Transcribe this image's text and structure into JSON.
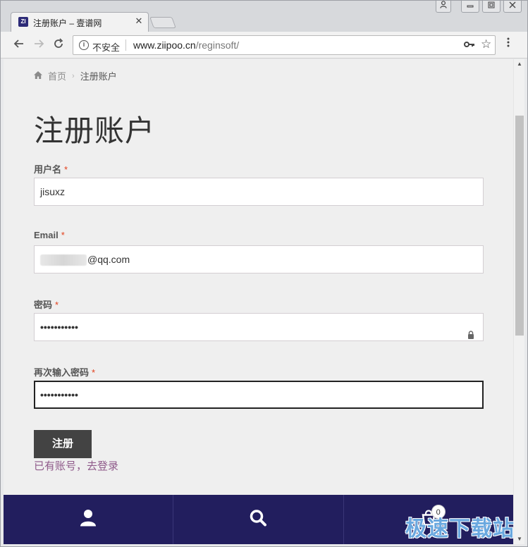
{
  "browser": {
    "tab_title": "注册账户 – 壹谱网",
    "favicon_text": "ZI",
    "tab_close": "✕",
    "security_label": "不安全",
    "url_host": "www.ziipoo.cn",
    "url_path": "/reginsoft/"
  },
  "page": {
    "breadcrumb": {
      "home": "首页",
      "separator": "›",
      "current": "注册账户"
    },
    "title": "注册账户",
    "required_mark": "*",
    "fields": {
      "username": {
        "label": "用户名",
        "value": "jisuxz"
      },
      "email": {
        "label": "Email",
        "value_visible": "@qq.com"
      },
      "password": {
        "label": "密码",
        "value": "•••••••••••"
      },
      "confirm_password": {
        "label": "再次输入密码",
        "value": "•••••••••••"
      }
    },
    "register_button": "注册",
    "login_link": "已有账号，去登录"
  },
  "bottom_bar": {
    "cart_count": "0",
    "items": [
      "account-icon",
      "search-icon",
      "cart-icon"
    ]
  },
  "watermark": "极速下载站",
  "colors": {
    "bottom_bar": "#221e5e",
    "button": "#434343",
    "link": "#8f5a8a",
    "required": "#e2401c"
  }
}
